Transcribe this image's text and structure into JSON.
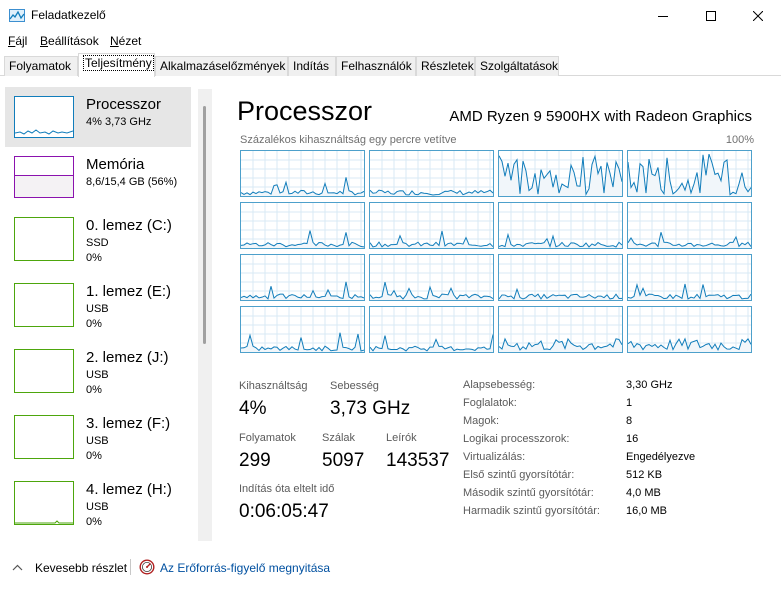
{
  "window": {
    "title": "Feladatkezelő",
    "controls": [
      "minimize-icon",
      "maximize-icon",
      "close-icon"
    ]
  },
  "menu": [
    {
      "label": "Fájl",
      "accel": "F",
      "rest": "ájl"
    },
    {
      "label": "Beállítások",
      "accel": "B",
      "rest": "eállítások"
    },
    {
      "label": "Nézet",
      "accel": "N",
      "rest": "ézet"
    }
  ],
  "tabs": [
    {
      "label": "Folyamatok",
      "active": false
    },
    {
      "label": "Teljesítmény",
      "active": true
    },
    {
      "label": "Alkalmazáselőzmények",
      "active": false
    },
    {
      "label": "Indítás",
      "active": false
    },
    {
      "label": "Felhasználók",
      "active": false
    },
    {
      "label": "Részletek",
      "active": false
    },
    {
      "label": "Szolgáltatások",
      "active": false
    }
  ],
  "sidebar": {
    "items": [
      {
        "name": "Processzor",
        "sub": "4%  3,73 GHz",
        "sub2": "",
        "color": "#117dbb",
        "selected": true
      },
      {
        "name": "Memória",
        "sub": "8,6/15,4 GB (56%)",
        "sub2": "",
        "color": "#8b12ae",
        "selected": false
      },
      {
        "name": "0. lemez (C:)",
        "sub": "SSD",
        "sub2": "0%",
        "color": "#4da60c",
        "selected": false
      },
      {
        "name": "1. lemez (E:)",
        "sub": "USB",
        "sub2": "0%",
        "color": "#4da60c",
        "selected": false
      },
      {
        "name": "2. lemez (J:)",
        "sub": "USB",
        "sub2": "0%",
        "color": "#4da60c",
        "selected": false
      },
      {
        "name": "3. lemez (F:)",
        "sub": "USB",
        "sub2": "0%",
        "color": "#4da60c",
        "selected": false
      },
      {
        "name": "4. lemez (H:)",
        "sub": "USB",
        "sub2": "0%",
        "color": "#4da60c",
        "selected": false
      }
    ]
  },
  "main": {
    "title": "Processzor",
    "cpu_name": "AMD Ryzen 9 5900HX with Radeon Graphics",
    "graph_caption": "Százalékos kihasználtság egy percre vetítve",
    "graph_max": "100%",
    "accent": "#117dbb"
  },
  "stats": {
    "utilization_label": "Kihasználtság",
    "utilization_value": "4%",
    "speed_label": "Sebesség",
    "speed_value": "3,73 GHz",
    "processes_label": "Folyamatok",
    "processes_value": "299",
    "threads_label": "Szálak",
    "threads_value": "5097",
    "handles_label": "Leírók",
    "handles_value": "143537",
    "uptime_label": "Indítás óta eltelt idő",
    "uptime_value": "0:06:05:47"
  },
  "specs": [
    {
      "key": "Alapsebesség:",
      "value": "3,30 GHz"
    },
    {
      "key": "Foglalatok:",
      "value": "1"
    },
    {
      "key": "Magok:",
      "value": "8"
    },
    {
      "key": "Logikai processzorok:",
      "value": "16"
    },
    {
      "key": "Virtualizálás:",
      "value": "Engedélyezve"
    },
    {
      "key": "Első szintű gyorsítótár:",
      "value": "512 KB"
    },
    {
      "key": "Második szintű gyorsítótár:",
      "value": "4,0 MB"
    },
    {
      "key": "Harmadik szintű gyorsítótár:",
      "value": "16,0 MB"
    }
  ],
  "footer": {
    "fewer_details": "Kevesebb részlet",
    "open_monitor": "Az Erőforrás-figyelő megnyitása"
  }
}
